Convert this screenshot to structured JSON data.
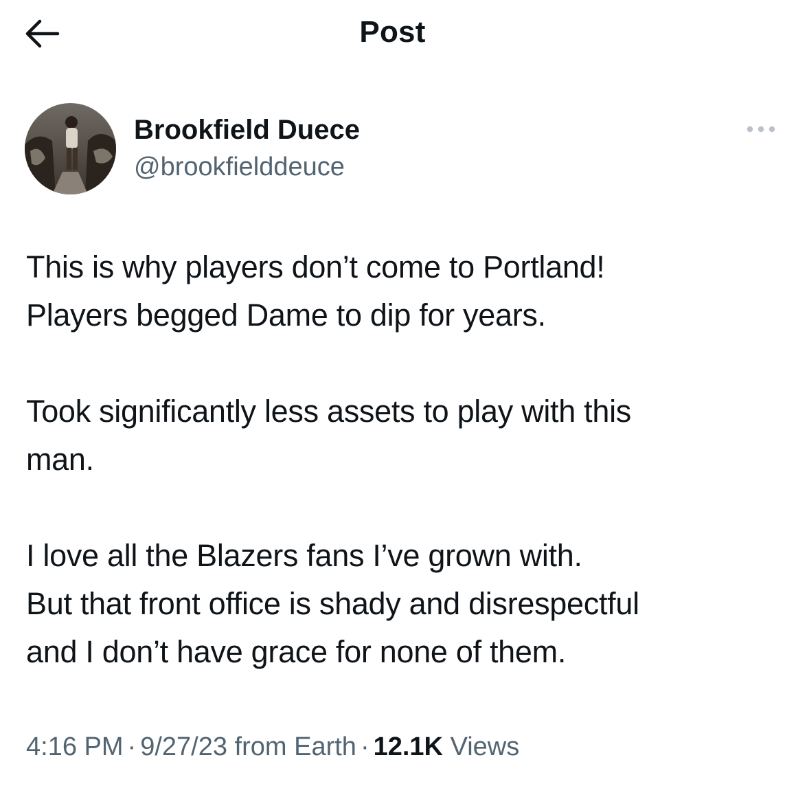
{
  "header": {
    "title": "Post",
    "back_icon": "arrow-left-icon"
  },
  "author": {
    "display_name": "Brookfield Duece",
    "handle": "@brookfielddeuce",
    "avatar_icon": "profile-photo"
  },
  "more_icon": "more-horizontal-icon",
  "tweet": {
    "paragraphs": [
      "This is why players don’t come to Portland!\nPlayers begged Dame to dip for years.",
      "Took significantly less assets to play with this\nman.",
      "I love all the Blazers fans I’ve grown with.\nBut that front office is shady and disrespectful\nand I don’t have grace for none of them."
    ]
  },
  "meta": {
    "time": "4:16 PM",
    "separator": "·",
    "date": "9/27/23",
    "source": "from Earth",
    "views_count": "12.1K",
    "views_label": "Views"
  },
  "colors": {
    "text_primary": "#0f1419",
    "text_secondary": "#536471",
    "background": "#ffffff"
  }
}
